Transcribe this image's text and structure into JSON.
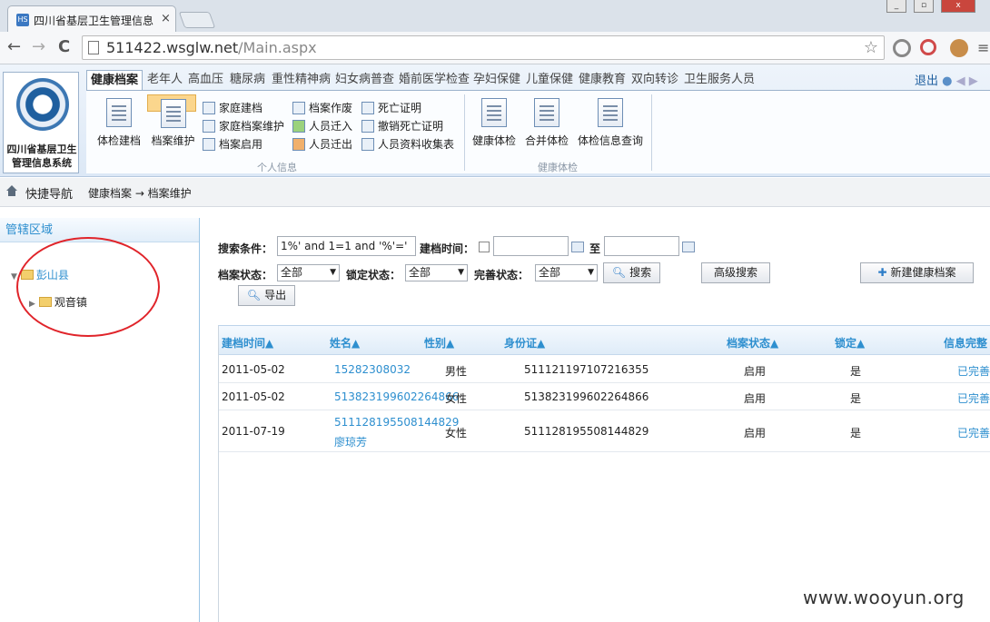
{
  "browser": {
    "tab_title": "四川省基层卫生管理信息",
    "tab_close": "×",
    "url_host": "511422.wsglw.net",
    "url_path": "/Main.aspx",
    "back": "←",
    "forward": "→",
    "reload": "C",
    "star": "☆"
  },
  "app": {
    "logo_text_line1": "四川省基层卫生",
    "logo_text_line2": "管理信息系统",
    "logout": "退出",
    "menu_tabs": [
      "健康档案",
      "老年人",
      "高血压",
      "糖尿病",
      "重性精神病",
      "妇女病普查",
      "婚前医学检查",
      "孕妇保健",
      "儿童保健",
      "健康教育",
      "双向转诊",
      "卫生服务人员"
    ],
    "ribbon": {
      "big_buttons": [
        "体检建档",
        "档案维护"
      ],
      "small_buttons_col1": [
        "家庭建档",
        "家庭档案维护",
        "档案启用"
      ],
      "small_buttons_col2": [
        "档案作废",
        "人员迁入",
        "人员迁出"
      ],
      "small_buttons_col3": [
        "死亡证明",
        "撤销死亡证明",
        "人员资料收集表"
      ],
      "group1_label": "个人信息",
      "big_buttons2": [
        "健康体检",
        "合并体检",
        "体检信息查询"
      ],
      "group2_label": "健康体检"
    }
  },
  "breadcrumb": {
    "quick_nav": "快捷导航",
    "path": "健康档案 → 档案维护"
  },
  "left_pane": {
    "title": "管辖区域",
    "tree_root": "彭山县",
    "tree_child": "观音镇"
  },
  "search": {
    "condition_label": "搜索条件：",
    "condition_value": "1%' and 1=1 and '%'='",
    "date_label": "建档时间：",
    "to_label": "至",
    "status_label": "档案状态：",
    "status_value": "全部",
    "lock_label": "锁定状态：",
    "lock_value": "全部",
    "complete_label": "完善状态：",
    "complete_value": "全部",
    "search_btn": "搜索",
    "advanced_btn": "高级搜索",
    "new_btn": "新建健康档案",
    "export_btn": "导出"
  },
  "grid": {
    "headers": [
      "建档时间",
      "姓名",
      "性别",
      "身份证",
      "档案状态",
      "锁定",
      "信息完整"
    ],
    "rows": [
      {
        "date": "2011-05-02",
        "name": "15282308032",
        "name2": "",
        "sex": "男性",
        "id": "511121197107216355",
        "status": "启用",
        "locked": "是",
        "complete": "已完善"
      },
      {
        "date": "2011-05-02",
        "name": "513823199602264866",
        "name2": "",
        "sex": "女性",
        "id": "513823199602264866",
        "status": "启用",
        "locked": "是",
        "complete": "已完善"
      },
      {
        "date": "2011-07-19",
        "name": "511128195508144829",
        "name2": "廖琼芳",
        "sex": "女性",
        "id": "511128195508144829",
        "status": "启用",
        "locked": "是",
        "complete": "已完善"
      }
    ]
  },
  "watermark": "www.wooyun.org",
  "colors": {
    "accent": "#2e8fcf",
    "annotation": "#e0242a",
    "selected_ribbon": "#fbd68d"
  }
}
